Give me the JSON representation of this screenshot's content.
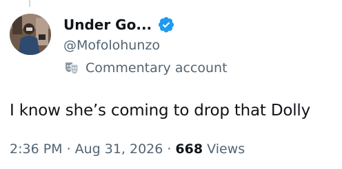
{
  "author": {
    "display_name": "Under Go...",
    "handle": "@Mofolohunzo",
    "verified": true,
    "label": "Commentary account"
  },
  "tweet": {
    "text": "I know she’s coming to drop that Dolly"
  },
  "meta": {
    "time": "2:36 PM",
    "separator": "·",
    "date": "Aug 31, 2026",
    "views_count": "668",
    "views_label": "Views"
  },
  "colors": {
    "text_primary": "#0f1419",
    "text_secondary": "#536471",
    "verified_blue": "#1d9bf0",
    "thread_line": "#cfd9de"
  },
  "icons": {
    "verified": "verified-badge-icon",
    "label": "theater-mask-icon"
  }
}
